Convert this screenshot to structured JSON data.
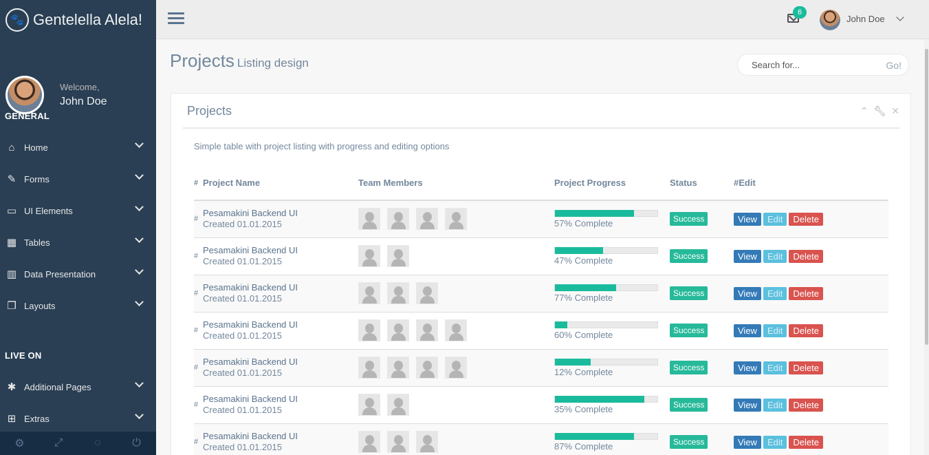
{
  "brand": {
    "title": "Gentelella Alela!",
    "icon": "paw-icon"
  },
  "profile": {
    "welcome": "Welcome,",
    "name": "John Doe"
  },
  "sidebar": {
    "section_general": "GENERAL",
    "section_live": "LIVE ON",
    "items": [
      {
        "label": "Home",
        "icon": "home-icon"
      },
      {
        "label": "Forms",
        "icon": "edit-icon"
      },
      {
        "label": "UI Elements",
        "icon": "desktop-icon"
      },
      {
        "label": "Tables",
        "icon": "table-icon"
      },
      {
        "label": "Data Presentation",
        "icon": "bar-chart-icon"
      },
      {
        "label": "Layouts",
        "icon": "clone-icon"
      },
      {
        "label": "Additional Pages",
        "icon": "bug-icon"
      },
      {
        "label": "Extras",
        "icon": "windows-icon"
      }
    ],
    "footer_icons": [
      "settings-icon",
      "fullscreen-icon",
      "eye-slash-icon",
      "power-icon"
    ]
  },
  "topnav": {
    "notification_count": "6",
    "user_name": "John Doe"
  },
  "page": {
    "title": "Projects",
    "subtitle": "Listing design"
  },
  "search": {
    "placeholder": "Search for...",
    "button": "Go!"
  },
  "panel": {
    "title": "Projects",
    "description": "Simple table with project listing with progress and editing options",
    "columns": [
      "#",
      "Project Name",
      "Team Members",
      "Project Progress",
      "Status",
      "#Edit"
    ],
    "rows": [
      {
        "hash": "#",
        "name": "Pesamakini Backend UI",
        "created": "Created 01.01.2015",
        "members": 4,
        "progress": 0.77,
        "progress_label": "57% Complete",
        "status": "Success"
      },
      {
        "hash": "#",
        "name": "Pesamakini Backend UI",
        "created": "Created 01.01.2015",
        "members": 2,
        "progress": 0.47,
        "progress_label": "47% Complete",
        "status": "Success"
      },
      {
        "hash": "#",
        "name": "Pesamakini Backend UI",
        "created": "Created 01.01.2015",
        "members": 3,
        "progress": 0.6,
        "progress_label": "77% Complete",
        "status": "Success"
      },
      {
        "hash": "#",
        "name": "Pesamakini Backend UI",
        "created": "Created 01.01.2015",
        "members": 4,
        "progress": 0.12,
        "progress_label": "60% Complete",
        "status": "Success"
      },
      {
        "hash": "#",
        "name": "Pesamakini Backend UI",
        "created": "Created 01.01.2015",
        "members": 4,
        "progress": 0.35,
        "progress_label": "12% Complete",
        "status": "Success"
      },
      {
        "hash": "#",
        "name": "Pesamakini Backend UI",
        "created": "Created 01.01.2015",
        "members": 2,
        "progress": 0.87,
        "progress_label": "35% Complete",
        "status": "Success"
      },
      {
        "hash": "#",
        "name": "Pesamakini Backend UI",
        "created": "Created 01.01.2015",
        "members": 3,
        "progress": 0.77,
        "progress_label": "87% Complete",
        "status": "Success"
      }
    ],
    "actions": {
      "view": "View",
      "edit": "Edit",
      "delete": "Delete"
    }
  },
  "colors": {
    "sidebar": "#2A3F54",
    "accent": "#1ABB9C",
    "view": "#337AB7",
    "edit": "#5BC0DE",
    "delete": "#D9534F"
  }
}
